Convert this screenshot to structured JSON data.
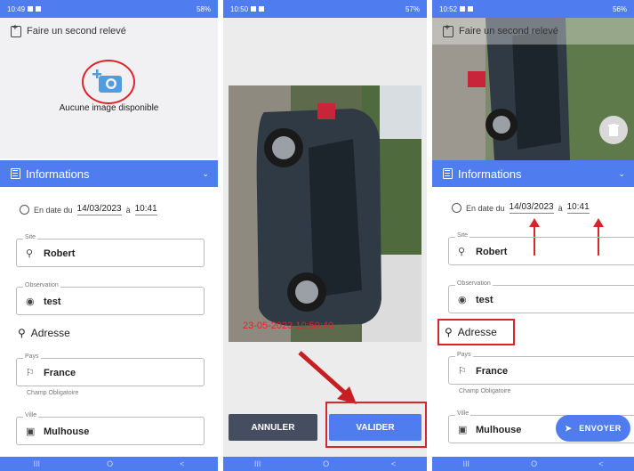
{
  "status": {
    "time1": "10:49",
    "time2": "10:50",
    "time3": "10:52",
    "battery1": "58%",
    "battery2": "57%",
    "battery3": "56%"
  },
  "form": {
    "title": "Faire un second relevé",
    "no_image": "Aucune image disponible",
    "section": "Informations",
    "date_prefix": "En date du",
    "date": "14/03/2023",
    "at": "à",
    "time": "10:41",
    "site_label": "Site",
    "site_value": "Robert",
    "obs_label": "Observation",
    "obs_value": "test",
    "address_heading": "Adresse",
    "pays_label": "Pays",
    "pays_value": "France",
    "required": "Champ Obligatoire",
    "ville_label": "Ville",
    "ville_value": "Mulhouse"
  },
  "preview": {
    "timestamp": "23-05-2023 10:50:40",
    "cancel": "ANNULER",
    "validate": "VALIDER"
  },
  "send_label": "ENVOYER",
  "nav": [
    "III",
    "O",
    "<"
  ],
  "colors": {
    "accent": "#4f7df0",
    "highlight": "#d6262c",
    "dark_button": "#454d60"
  }
}
